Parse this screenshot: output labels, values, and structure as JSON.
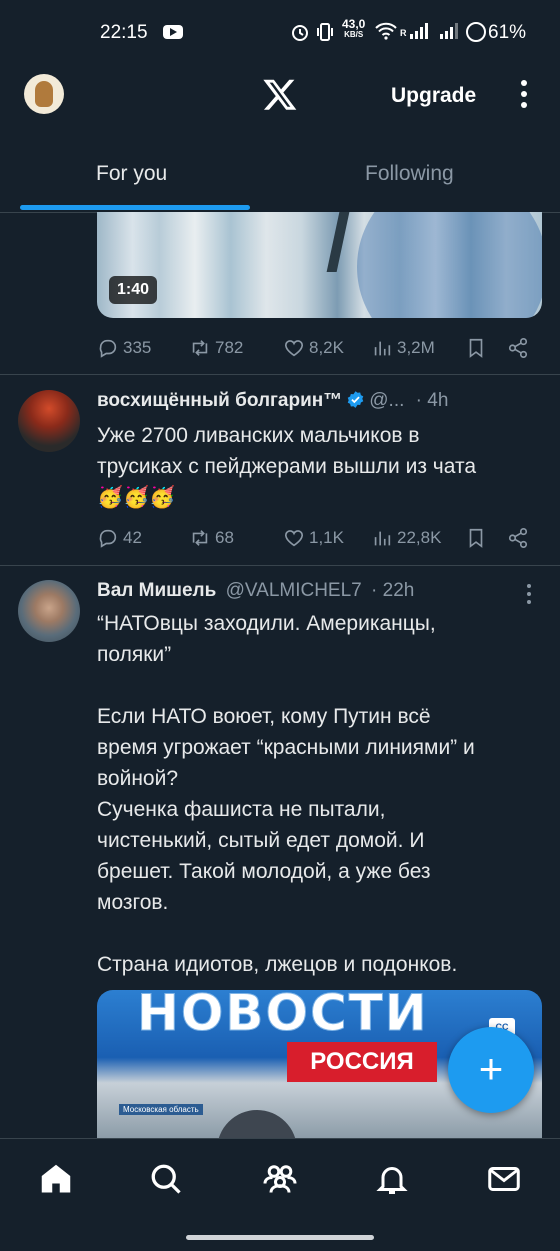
{
  "status_bar": {
    "time": "22:15",
    "net_speed_value": "43,0",
    "net_speed_unit": "KB/S",
    "signal_label": "R",
    "battery": "61%"
  },
  "header": {
    "upgrade_label": "Upgrade"
  },
  "tabs": [
    {
      "label": "For you",
      "active": true
    },
    {
      "label": "Following",
      "active": false
    }
  ],
  "post0": {
    "media_duration": "1:40",
    "stats": {
      "replies": "335",
      "reposts": "782",
      "likes": "8,2K",
      "views": "3,2M"
    }
  },
  "post1": {
    "name": "восхищённый болгарин™",
    "verified": true,
    "handle": "@...",
    "time": "· 4h",
    "text": "Уже 2700 ливанских мальчиков в\nтрусиках с пейджерами вышли из чата\n🥳🥳🥳",
    "stats": {
      "replies": "42",
      "reposts": "68",
      "likes": "1,1K",
      "views": "22,8K"
    }
  },
  "post2": {
    "name": "Вал Мишель",
    "handle": "@VALMICHEL7",
    "time": "· 22h",
    "text": "“НАТОвцы заходили. Американцы,\nполяки”\n\nЕсли НАТО воюет, кому Путин всё\nвремя угрожает “красными линиями” и\nвойной?\nСученка фашиста не пытали,\nчистенький, сытый едет домой. И\nбрешет. Такой молодой, а уже без\nмозгов.\n\nСтрана идиотов, лжецов и подонков.",
    "media": {
      "headline": "НОВОСТИ",
      "subhead": "РОССИЯ",
      "caption_badge": "CC",
      "location": "Московская область"
    }
  },
  "colors": {
    "background": "#15202b",
    "accent": "#1d9bf0",
    "muted": "#8b98a5",
    "divider": "#38444d"
  },
  "icons": [
    "x-logo-icon",
    "more-vertical-icon",
    "reply-icon",
    "repost-icon",
    "like-icon",
    "views-icon",
    "bookmark-icon",
    "share-icon",
    "verified-icon",
    "compose-icon",
    "home-icon",
    "search-icon",
    "communities-icon",
    "notifications-icon",
    "messages-icon"
  ]
}
